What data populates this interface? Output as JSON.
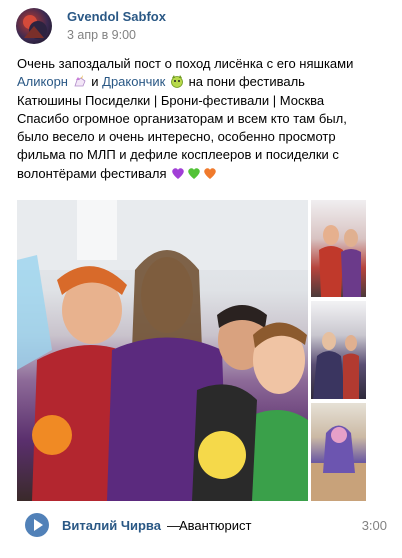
{
  "post": {
    "author": "Gvendol Sabfox",
    "date": "3 апр в 9:00",
    "text": {
      "line1": "Очень запоздалый пост о поход лисёнка с его няшками",
      "link1": "Аликорн",
      "and": "и",
      "link2": "Дракончик",
      "line2_rest": "на пони фестиваль",
      "line3": "Катюшины Посиделки | Брони-фестивали | Москва",
      "line4": "Спасибо огромное организаторам и всем кто там был,",
      "line5": "было весело и очень интересно, особенно просмотр",
      "line6": "фильма по МЛП и дефиле косплееров и посиделки с",
      "line7": "волонтёрами фестиваля"
    },
    "emoji": {
      "unicorn": "unicorn-emoji",
      "dragon": "dragon-emoji",
      "hearts": [
        "purple-heart",
        "green-heart",
        "orange-heart"
      ]
    },
    "photos": {
      "main": "group-photo",
      "side": [
        "cosplay-photo-1",
        "cosplay-photo-2",
        "cosplay-photo-3"
      ]
    },
    "audio": {
      "artist": "Виталий Чирва",
      "separator": "—",
      "title": "Авантюрист",
      "duration": "3:00"
    },
    "colors": {
      "link": "#2a5885",
      "meta": "#828282",
      "play": "#5181b8"
    }
  }
}
